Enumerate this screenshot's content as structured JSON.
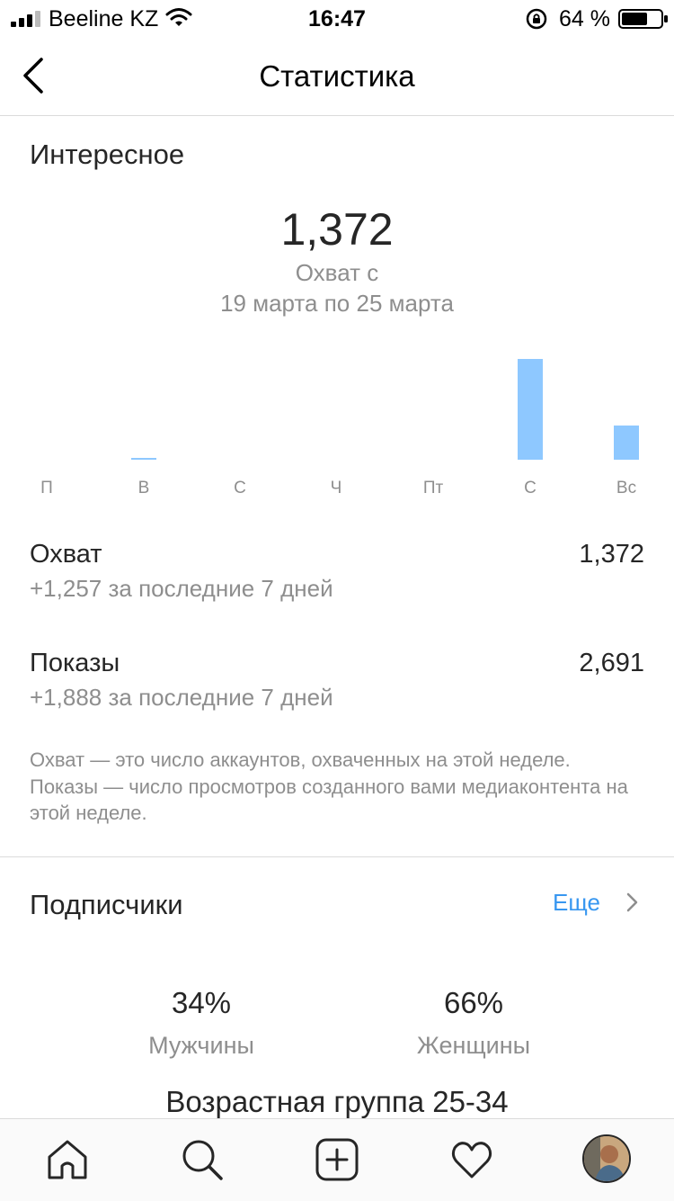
{
  "status_bar": {
    "carrier": "Beeline KZ",
    "time": "16:47",
    "battery_percent": "64 %",
    "icons": [
      "signal-icon",
      "wifi-icon",
      "rotation-lock-icon",
      "battery-icon"
    ]
  },
  "nav": {
    "title": "Статистика",
    "back_icon": "chevron-left-icon"
  },
  "discovery": {
    "title": "Интересное",
    "total": "1,372",
    "caption_line1": "Охват с",
    "caption_line2": "19 марта по 25 марта"
  },
  "chart_data": {
    "type": "bar",
    "categories": [
      "П",
      "В",
      "С",
      "Ч",
      "Пт",
      "С",
      "Вс"
    ],
    "values": [
      0,
      2,
      0,
      0,
      0,
      112,
      38
    ],
    "ylim": [
      0,
      112
    ],
    "color": "#8ec8ff"
  },
  "metrics": [
    {
      "label": "Охват",
      "value": "1,372",
      "change": "+1,257 за последние 7 дней"
    },
    {
      "label": "Показы",
      "value": "2,691",
      "change": "+1,888 за последние 7 дней"
    }
  ],
  "note": "Охват — это число аккаунтов, охваченных на этой неделе. Показы — число просмотров созданного вами медиаконтента на этой неделе.",
  "followers": {
    "title": "Подписчики",
    "more": "Еще",
    "men_pct": "34%",
    "men_label": "Мужчины",
    "women_pct": "66%",
    "women_label": "Женщины",
    "age_group": "Возрастная группа 25-34"
  },
  "tab_bar": {
    "icons": [
      "home-icon",
      "search-icon",
      "add-post-icon",
      "heart-icon",
      "profile-avatar"
    ]
  },
  "colors": {
    "accent": "#3897f0",
    "bar": "#8ec8ff",
    "secondary_text": "#8e8e8e",
    "divider": "#dbdbdb"
  }
}
